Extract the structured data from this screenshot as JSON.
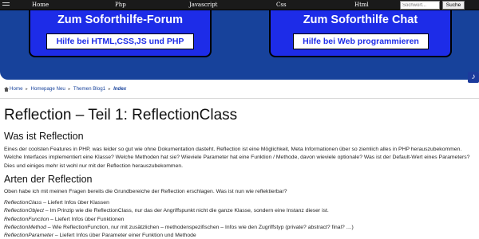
{
  "nav": {
    "items": [
      "Home",
      "Php",
      "Javascript",
      "Css",
      "Html"
    ]
  },
  "search": {
    "placeholder": "Sochwort...",
    "button_label": "Suche"
  },
  "banner": {
    "promo_left": {
      "title": "Zum Soforthilfe-Forum",
      "subtitle": "Hilfe bei HTML,CSS,JS und PHP"
    },
    "promo_right": {
      "title": "Zum Soforthilfe Chat",
      "subtitle": "Hilfe bei Web programmieren"
    }
  },
  "breadcrumb": {
    "items": [
      "Home",
      "Homepage Neu",
      "Themen Blog1"
    ],
    "current": "Index"
  },
  "article": {
    "title": "Reflection – Teil 1: ReflectionClass",
    "section1_heading": "Was ist Reflection",
    "section1_text": "Eines der coolsten Features in PHP, was leider so gut wie ohne Dokumentation dasteht. Reflection ist eine Möglichkeit, Meta Informationen über so ziemlich alles in PHP herauszubekommen. Welche Interfaces implementiert eine Klasse? Welche Methoden hat sie? Wieviele Parameter hat eine Funktion / Methode, davon wieviele optionale? Was ist der Default-Wert eines Parameters? Dies und einiges mehr ist wohl nur mit der Reflection herauszubekommen.",
    "section2_heading": "Arten der Reflection",
    "section2_intro": "Oben habe ich mit meinen Fragen bereits die Grundbereiche der Reflection erschlagen. Was ist nun wie reflektierbar?",
    "list": [
      {
        "term": "ReflectionClass",
        "desc": " – Liefert Infos über Klassen"
      },
      {
        "term": "ReflectionObject",
        "desc": " – Im Prinzip wie die ReflectionClass, nur das der Angriffspunkt nicht die ganze Klasse, sondern eine Instanz dieser ist."
      },
      {
        "term": "ReflectionFunction",
        "desc": " – Liefert Infos über Funktionen"
      },
      {
        "term": "ReflectionMethod",
        "desc": " – Wie ReflectionFunction, nur mit zusätzlichen – methodenspezifischen – Infos wie den Zugriffstyp (private? abstract? final? …)"
      },
      {
        "term": "ReflectionParameter",
        "desc": " – Liefert Infos über Parameter einer Funktion und Methode"
      }
    ]
  },
  "colors": {
    "topbar": "#1a1a1a",
    "banner": "#17429b",
    "promo": "#1d2ce8",
    "link": "#17429b"
  },
  "icons": {
    "menu": "menu-icon",
    "home": "home-icon",
    "music": "music-note-icon"
  }
}
